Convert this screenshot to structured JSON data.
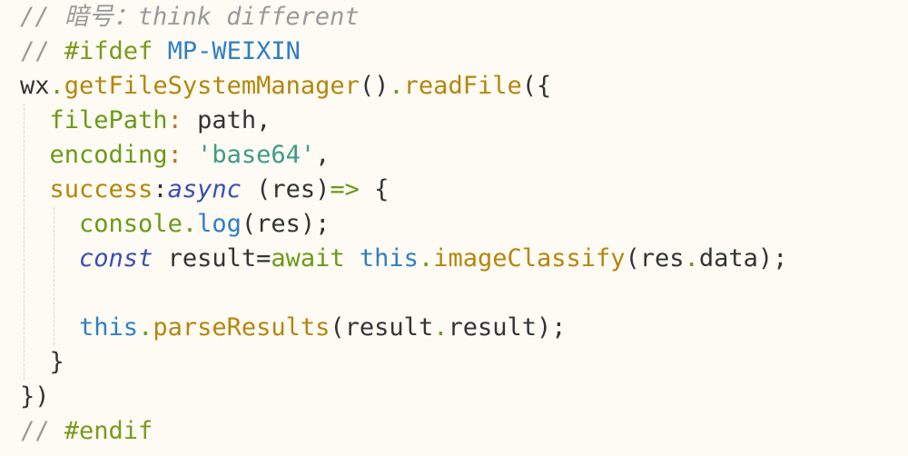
{
  "lines": [
    {
      "indent": "",
      "tokens": [
        {
          "type": "comment",
          "text": "// 暗号：think different"
        }
      ]
    },
    {
      "indent": "",
      "tokens": [
        {
          "type": "pre-comment",
          "text": "// "
        },
        {
          "type": "directive",
          "text": "#ifdef "
        },
        {
          "type": "macro",
          "text": "MP-WEIXIN"
        }
      ]
    },
    {
      "indent": "",
      "tokens": [
        {
          "type": "ident",
          "text": "wx"
        },
        {
          "type": "dot",
          "text": "."
        },
        {
          "type": "func",
          "text": "getFileSystemManager"
        },
        {
          "type": "punc",
          "text": "()"
        },
        {
          "type": "dot",
          "text": "."
        },
        {
          "type": "func",
          "text": "readFile"
        },
        {
          "type": "punc",
          "text": "({"
        }
      ]
    },
    {
      "indent": "  ",
      "tokens": [
        {
          "type": "key",
          "text": "filePath"
        },
        {
          "type": "colon",
          "text": ":"
        },
        {
          "type": "ident",
          "text": " path,"
        }
      ]
    },
    {
      "indent": "  ",
      "tokens": [
        {
          "type": "key",
          "text": "encoding"
        },
        {
          "type": "colon",
          "text": ":"
        },
        {
          "type": "str",
          "text": " 'base64'"
        },
        {
          "type": "punc",
          "text": ","
        }
      ]
    },
    {
      "indent": "  ",
      "tokens": [
        {
          "type": "func",
          "text": "success"
        },
        {
          "type": "punc",
          "text": ":"
        },
        {
          "type": "keyword-it",
          "text": "async"
        },
        {
          "type": "punc",
          "text": " (res)"
        },
        {
          "type": "key",
          "text": "=>"
        },
        {
          "type": "punc",
          "text": " {"
        }
      ]
    },
    {
      "indent": "    ",
      "tokens": [
        {
          "type": "key",
          "text": "console"
        },
        {
          "type": "dot",
          "text": "."
        },
        {
          "type": "log",
          "text": "log"
        },
        {
          "type": "punc",
          "text": "(res);"
        }
      ]
    },
    {
      "indent": "    ",
      "tokens": [
        {
          "type": "keyword-it",
          "text": "const"
        },
        {
          "type": "ident",
          "text": " result="
        },
        {
          "type": "await",
          "text": "await"
        },
        {
          "type": "ident",
          "text": " "
        },
        {
          "type": "this",
          "text": "this"
        },
        {
          "type": "dot",
          "text": "."
        },
        {
          "type": "func",
          "text": "imageClassify"
        },
        {
          "type": "punc",
          "text": "(res"
        },
        {
          "type": "dot",
          "text": "."
        },
        {
          "type": "ident",
          "text": "data);"
        }
      ]
    },
    {
      "indent": "",
      "tokens": []
    },
    {
      "indent": "    ",
      "tokens": [
        {
          "type": "this",
          "text": "this"
        },
        {
          "type": "dot",
          "text": "."
        },
        {
          "type": "func",
          "text": "parseResults"
        },
        {
          "type": "punc",
          "text": "(result"
        },
        {
          "type": "dot",
          "text": "."
        },
        {
          "type": "ident",
          "text": "result);"
        }
      ]
    },
    {
      "indent": "  ",
      "tokens": [
        {
          "type": "punc",
          "text": "}"
        }
      ]
    },
    {
      "indent": "",
      "tokens": [
        {
          "type": "punc",
          "text": "})"
        }
      ]
    },
    {
      "indent": "",
      "tokens": [
        {
          "type": "pre-comment",
          "text": "// "
        },
        {
          "type": "directive",
          "text": "#endif"
        }
      ]
    }
  ]
}
